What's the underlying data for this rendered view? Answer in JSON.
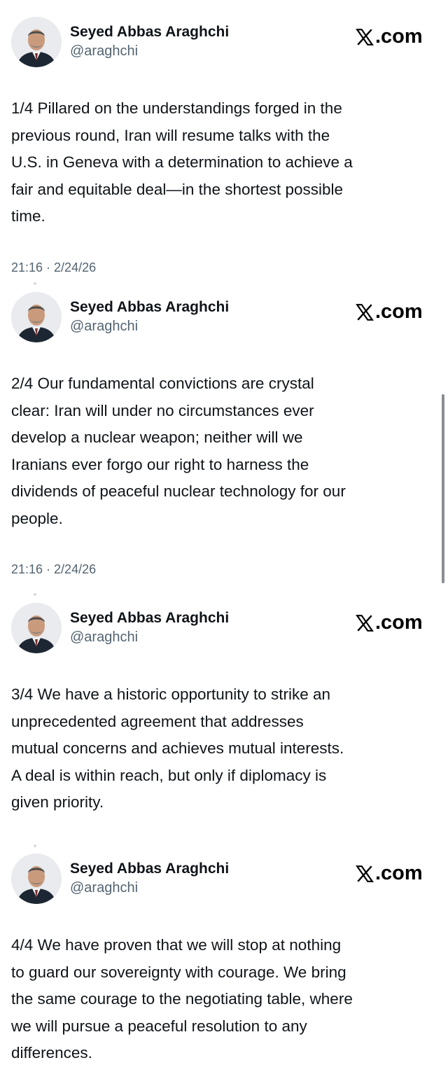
{
  "tweets": [
    {
      "name": "Seyed Abbas Araghchi",
      "handle": "@araghchi",
      "brand": ".com",
      "brand_icon": "x-logo-icon",
      "text": "1/4 Pillared on the understandings forged in the\nprevious round, Iran will resume talks with the\nU.S. in Geneva with a determination to achieve a\nfair and equitable deal—in the shortest possible\ntime.",
      "time": "21:16 · 2/24/26"
    },
    {
      "name": "Seyed Abbas Araghchi",
      "handle": "@araghchi",
      "brand": ".com",
      "brand_icon": "x-logo-icon",
      "text": "2/4 Our fundamental convictions are crystal\nclear: Iran will under no circumstances ever\ndevelop a nuclear weapon; neither will we\nIranians ever forgo our right to harness the\ndividends of peaceful nuclear technology for our\npeople.",
      "time": "21:16 · 2/24/26"
    },
    {
      "name": "Seyed Abbas Araghchi",
      "handle": "@araghchi",
      "brand": ".com",
      "brand_icon": "x-logo-icon",
      "text": "3/4 We have a historic opportunity to strike an\nunprecedented agreement that addresses\nmutual concerns and achieves mutual interests.\nA deal is within reach, but only if diplomacy is\ngiven priority."
    },
    {
      "name": "Seyed Abbas Araghchi",
      "handle": "@araghchi",
      "brand": ".com",
      "brand_icon": "x-logo-icon",
      "text": "4/4 We have proven that we will stop at nothing\nto guard our sovereignty with courage. We bring\nthe same courage to the negotiating table, where\nwe will pursue a peaceful resolution to any\ndifferences."
    }
  ],
  "colors": {
    "text": "#0f1419",
    "secondary": "#536471",
    "scrollbar": "#8b8f94"
  }
}
